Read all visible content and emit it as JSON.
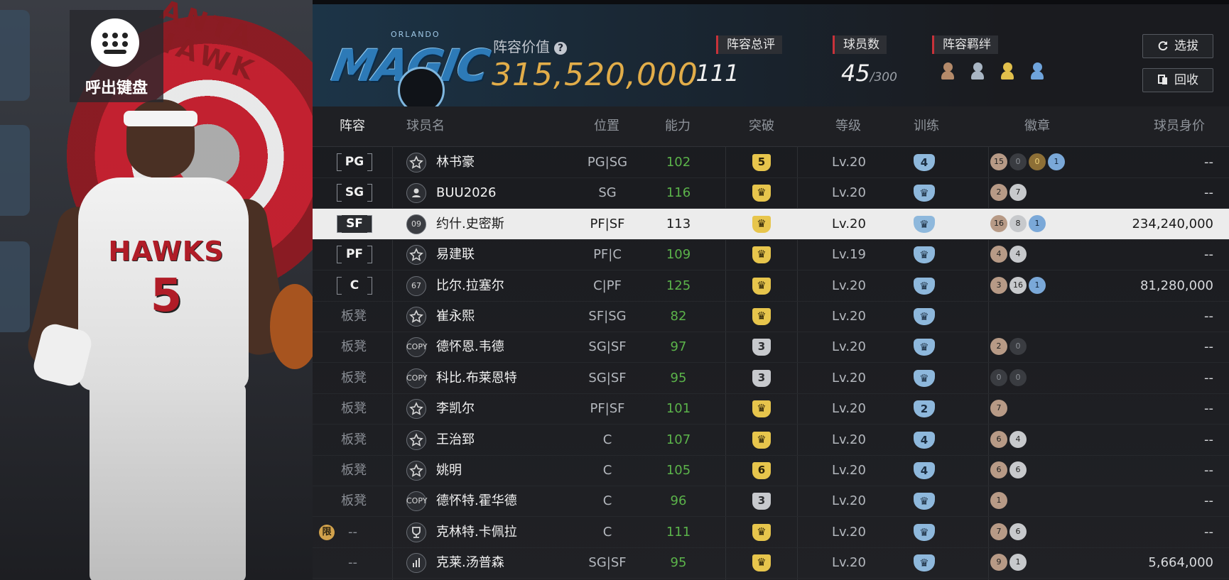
{
  "hero": {
    "keyboard_label": "呼出键盘",
    "jersey_team": "HAWKS",
    "jersey_number": "5",
    "logo_text": "ANTA HAWK"
  },
  "header": {
    "team_logo_word": "MAGIC",
    "team_logo_small": "ORLANDO",
    "value_label": "阵容价值",
    "value_help_icon": "?",
    "value": "315,520,000",
    "stats": [
      {
        "label": "阵容总评",
        "value": "111",
        "suffix": ""
      },
      {
        "label": "球员数",
        "value": "45",
        "suffix": "/300"
      },
      {
        "label": "阵容羁绊",
        "value": "",
        "suffix": ""
      }
    ],
    "buttons": {
      "select": "选拔",
      "recycle": "回收"
    }
  },
  "columns": [
    "阵容",
    "球员名",
    "位置",
    "能力",
    "突破",
    "等级",
    "训练",
    "徽章",
    "球员身价"
  ],
  "rows": [
    {
      "slot": "PG",
      "slot_type": "pos",
      "icon": "star",
      "icon_text": "",
      "name": "林书豪",
      "position": "PG|SG",
      "ability": "102",
      "break": "5",
      "break_type": "gold",
      "level": "Lv.20",
      "train": "4",
      "badges": [
        [
          "15",
          "bronze"
        ],
        [
          "0",
          "dark"
        ],
        [
          "0",
          "gold"
        ],
        [
          "1",
          "blue"
        ]
      ],
      "price": "--",
      "selected": false
    },
    {
      "slot": "SG",
      "slot_type": "pos",
      "icon": "person",
      "icon_text": "",
      "name": "BUU2026",
      "position": "SG",
      "ability": "116",
      "break": "♛",
      "break_type": "gold",
      "level": "Lv.20",
      "train": "♛",
      "badges": [
        [
          "2",
          "bronze"
        ],
        [
          "7",
          "silver"
        ]
      ],
      "price": "--",
      "selected": false
    },
    {
      "slot": "SF",
      "slot_type": "pos",
      "icon": "hex",
      "icon_text": "09",
      "name": "约什.史密斯",
      "position": "PF|SF",
      "ability": "113",
      "break": "♛",
      "break_type": "gold",
      "level": "Lv.20",
      "train": "♛",
      "badges": [
        [
          "16",
          "bronze"
        ],
        [
          "8",
          "silver"
        ],
        [
          "1",
          "blue"
        ]
      ],
      "price": "234,240,000",
      "selected": true
    },
    {
      "slot": "PF",
      "slot_type": "pos",
      "icon": "star",
      "icon_text": "",
      "name": "易建联",
      "position": "PF|C",
      "ability": "109",
      "break": "♛",
      "break_type": "gold",
      "level": "Lv.19",
      "train": "♛",
      "badges": [
        [
          "4",
          "bronze"
        ],
        [
          "4",
          "silver"
        ]
      ],
      "price": "--",
      "selected": false
    },
    {
      "slot": "C",
      "slot_type": "pos",
      "icon": "hex",
      "icon_text": "67",
      "name": "比尔.拉塞尔",
      "position": "C|PF",
      "ability": "125",
      "break": "♛",
      "break_type": "gold",
      "level": "Lv.20",
      "train": "♛",
      "badges": [
        [
          "3",
          "bronze"
        ],
        [
          "16",
          "silver"
        ],
        [
          "1",
          "blue"
        ]
      ],
      "price": "81,280,000",
      "selected": false
    },
    {
      "slot": "板凳",
      "slot_type": "bench",
      "icon": "star",
      "icon_text": "",
      "name": "崔永熙",
      "position": "SF|SG",
      "ability": "82",
      "break": "♛",
      "break_type": "gold",
      "level": "Lv.20",
      "train": "♛",
      "badges": [],
      "price": "--",
      "selected": false
    },
    {
      "slot": "板凳",
      "slot_type": "bench",
      "icon": "copy",
      "icon_text": "COPY",
      "name": "德怀恩.韦德",
      "position": "SG|SF",
      "ability": "97",
      "break": "3",
      "break_type": "gray",
      "level": "Lv.20",
      "train": "♛",
      "badges": [
        [
          "2",
          "bronze"
        ],
        [
          "0",
          "dark"
        ]
      ],
      "price": "--",
      "selected": false
    },
    {
      "slot": "板凳",
      "slot_type": "bench",
      "icon": "copy",
      "icon_text": "COPY",
      "name": "科比.布莱恩特",
      "position": "SG|SF",
      "ability": "95",
      "break": "3",
      "break_type": "gray",
      "level": "Lv.20",
      "train": "♛",
      "badges": [
        [
          "0",
          "dark"
        ],
        [
          "0",
          "dark"
        ]
      ],
      "price": "--",
      "selected": false
    },
    {
      "slot": "板凳",
      "slot_type": "bench",
      "icon": "star",
      "icon_text": "",
      "name": "李凯尔",
      "position": "PF|SF",
      "ability": "101",
      "break": "♛",
      "break_type": "gold",
      "level": "Lv.20",
      "train": "2",
      "badges": [
        [
          "7",
          "bronze"
        ]
      ],
      "price": "--",
      "selected": false
    },
    {
      "slot": "板凳",
      "slot_type": "bench",
      "icon": "star",
      "icon_text": "",
      "name": "王治郅",
      "position": "C",
      "ability": "107",
      "break": "♛",
      "break_type": "gold",
      "level": "Lv.20",
      "train": "4",
      "badges": [
        [
          "6",
          "bronze"
        ],
        [
          "4",
          "silver"
        ]
      ],
      "price": "--",
      "selected": false
    },
    {
      "slot": "板凳",
      "slot_type": "bench",
      "icon": "star",
      "icon_text": "",
      "name": "姚明",
      "position": "C",
      "ability": "105",
      "break": "6",
      "break_type": "gold",
      "level": "Lv.20",
      "train": "4",
      "badges": [
        [
          "6",
          "bronze"
        ],
        [
          "6",
          "silver"
        ]
      ],
      "price": "--",
      "selected": false
    },
    {
      "slot": "板凳",
      "slot_type": "bench",
      "icon": "copy",
      "icon_text": "COPY",
      "name": "德怀特.霍华德",
      "position": "C",
      "ability": "96",
      "break": "3",
      "break_type": "gray",
      "level": "Lv.20",
      "train": "♛",
      "badges": [
        [
          "1",
          "bronze"
        ]
      ],
      "price": "--",
      "selected": false
    },
    {
      "slot": "--",
      "slot_type": "limited",
      "limit_text": "限",
      "icon": "trophy",
      "icon_text": "",
      "name": "克林特.卡佩拉",
      "position": "C",
      "ability": "111",
      "break": "♛",
      "break_type": "gold",
      "level": "Lv.20",
      "train": "♛",
      "badges": [
        [
          "7",
          "bronze"
        ],
        [
          "6",
          "silver"
        ]
      ],
      "price": "--",
      "selected": false
    },
    {
      "slot": "--",
      "slot_type": "dash",
      "icon": "bars",
      "icon_text": "",
      "name": "克莱.汤普森",
      "position": "SG|SF",
      "ability": "95",
      "break": "♛",
      "break_type": "gold",
      "level": "Lv.20",
      "train": "♛",
      "badges": [
        [
          "9",
          "bronze"
        ],
        [
          "1",
          "silver"
        ]
      ],
      "price": "5,664,000",
      "selected": false
    }
  ],
  "colors": {
    "accent_gold": "#e2ad49",
    "ability_green": "#5bb34a",
    "train_blue": "#8eb8dc",
    "tag_red": "#c8323a"
  }
}
